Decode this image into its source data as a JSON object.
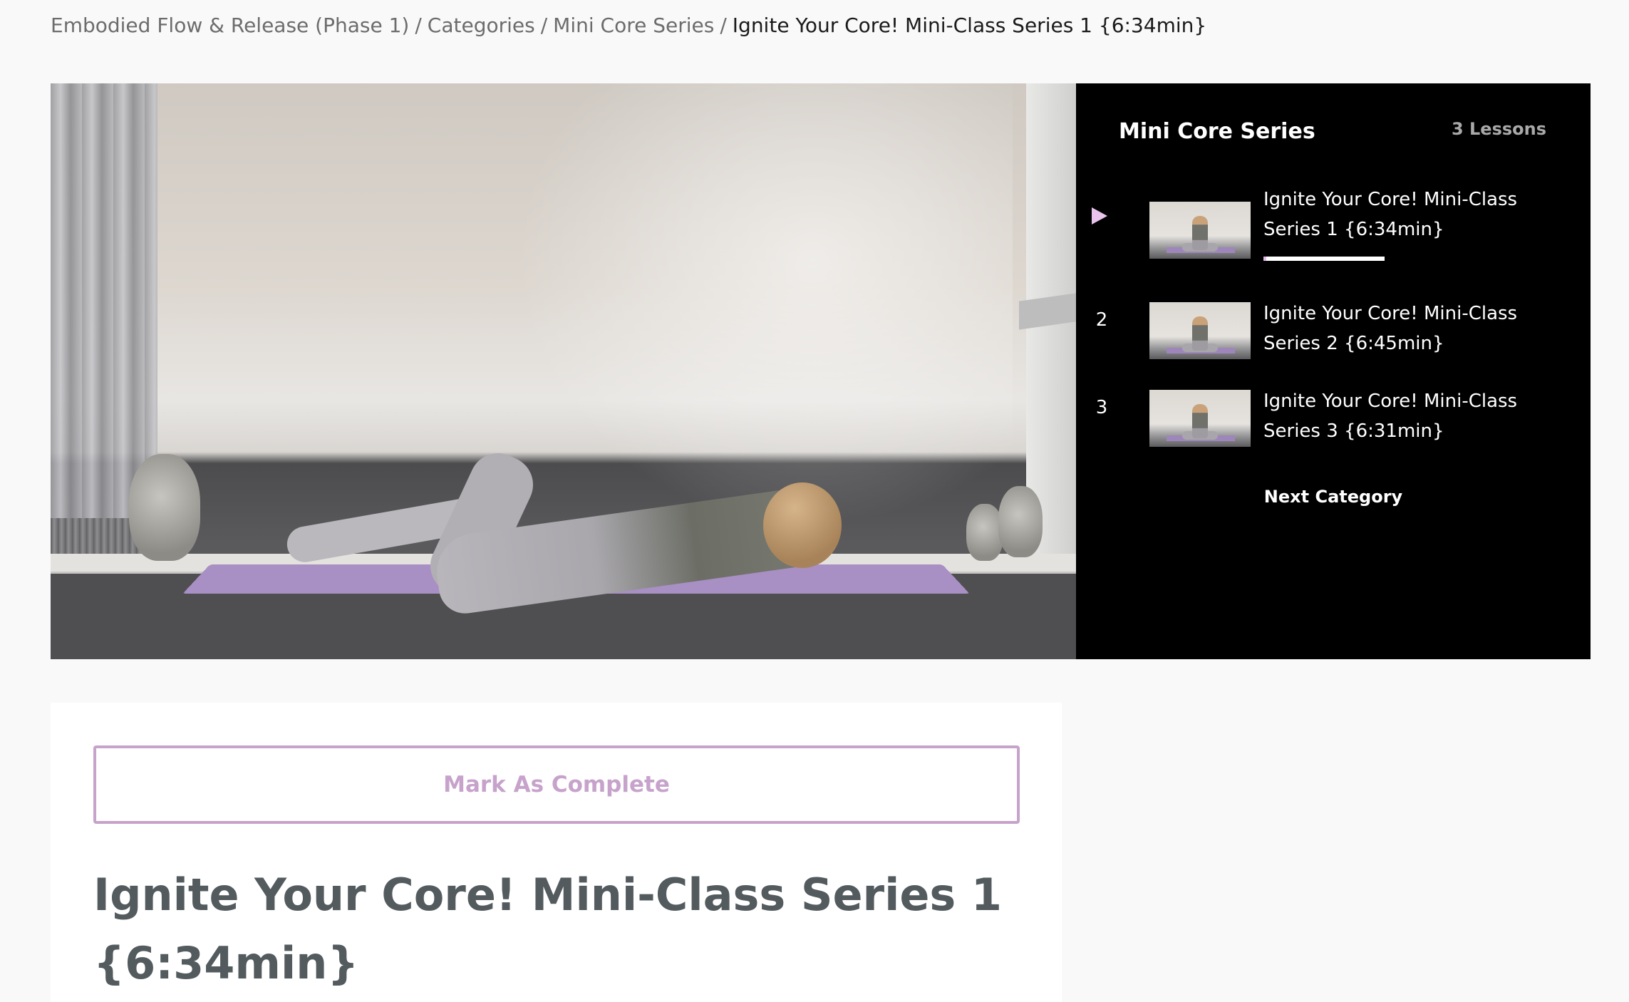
{
  "breadcrumb": {
    "items": [
      "Embodied Flow & Release (Phase 1)",
      "Categories",
      "Mini Core Series"
    ],
    "separator": "/",
    "current": "Ignite Your Core! Mini-Class Series 1 {6:34min}"
  },
  "video": {
    "icon": "video-frame"
  },
  "sidebar": {
    "title": "Mini Core Series",
    "lesson_count": "3 Lessons",
    "lessons": [
      {
        "marker": "play-icon",
        "title": "Ignite Your Core! Mini-Class Series 1 {6:34min}",
        "progress": 0.4,
        "active": true
      },
      {
        "marker": "2",
        "title": "Ignite Your Core! Mini-Class Series 2 {6:45min}",
        "active": false
      },
      {
        "marker": "3",
        "title": "Ignite Your Core! Mini-Class Series 3 {6:31min}",
        "active": false
      }
    ],
    "next_category_label": "Next Category"
  },
  "content": {
    "complete_button_label": "Mark As Complete",
    "heading": "Ignite Your Core! Mini-Class Series 1 {6:34min}"
  },
  "colors": {
    "accent": "#c7a3cc",
    "sidebar_bg": "#000000",
    "page_bg": "#f9f9f9",
    "heading": "#535b5e"
  }
}
